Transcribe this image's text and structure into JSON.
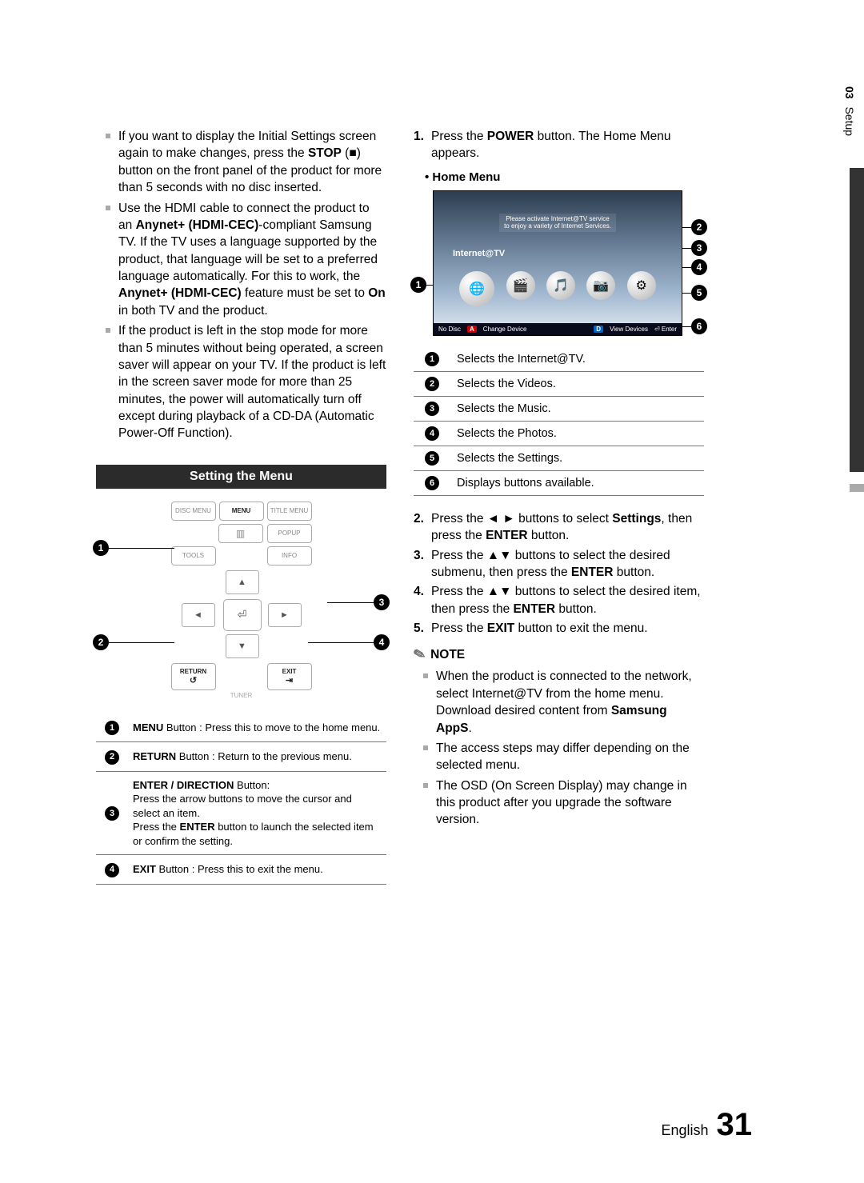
{
  "section": {
    "num": "03",
    "name": "Setup"
  },
  "left": {
    "bullets": [
      {
        "pre": "If you want to display the Initial Settings screen again to make changes, press the ",
        "b1": "STOP",
        "post": " (■) button on the front panel of the product for more than 5 seconds with no disc inserted."
      },
      {
        "pre": "Use the HDMI cable to connect the product to an ",
        "b1": "Anynet+ (HDMI-CEC)",
        "mid": "-compliant Samsung TV. If the TV uses a language supported by the product, that language will be set to a preferred language automatically. For this to work, the ",
        "b2": "Anynet+ (HDMI-CEC)",
        "mid2": " feature must be set to ",
        "b3": "On",
        "post": " in both TV and the product."
      },
      {
        "pre": "If the product is left in the stop mode for more than 5 minutes without being operated, a screen saver will appear on your TV. If the product is left in the screen saver mode for more than 25 minutes, the power will automatically turn off except during playback of a CD-DA (Automatic Power-Off Function)."
      }
    ],
    "band": "Setting the Menu",
    "remote": {
      "disc_menu": "DISC MENU",
      "menu": "MENU",
      "title_menu": "TITLE MENU",
      "popup": "POPUP",
      "tools": "TOOLS",
      "info": "INFO",
      "return": "RETURN",
      "exit": "EXIT",
      "tuner": "TUNER"
    },
    "remote_callouts": {
      "c1": "1",
      "c2": "2",
      "c3": "3",
      "c4": "4"
    },
    "remote_table": [
      {
        "n": "1",
        "b": "MENU",
        "rest": " Button : Press this to move to the home menu."
      },
      {
        "n": "2",
        "b": "RETURN",
        "rest": " Button : Return to the previous menu."
      },
      {
        "n": "3",
        "b": "ENTER / DIRECTION",
        "rest": " Button:\nPress the arrow buttons to move the cursor and select an item.\nPress the ",
        "b2": "ENTER",
        "rest2": " button to launch the selected item or confirm the setting."
      },
      {
        "n": "4",
        "b": "EXIT",
        "rest": " Button : Press this to exit the menu."
      }
    ]
  },
  "right": {
    "step1": {
      "n": "1.",
      "pre": "Press the ",
      "b": "POWER",
      "post": " button. The Home Menu appears."
    },
    "home_menu_label": "• Home Menu",
    "tv": {
      "banner1": "Please activate Internet@TV service",
      "banner2": "to enjoy a variety of Internet Services.",
      "label": "Internet@TV",
      "bar_nodisc": "No Disc",
      "bar_a": "A",
      "bar_change": "Change Device",
      "bar_d": "D",
      "bar_view": "View Devices",
      "bar_enter": "⏎ Enter"
    },
    "tv_callouts": {
      "c1": "1",
      "c2": "2",
      "c3": "3",
      "c4": "4",
      "c5": "5",
      "c6": "6"
    },
    "home_table": [
      {
        "n": "1",
        "t": "Selects the Internet@TV."
      },
      {
        "n": "2",
        "t": "Selects the Videos."
      },
      {
        "n": "3",
        "t": "Selects the Music."
      },
      {
        "n": "4",
        "t": "Selects the Photos."
      },
      {
        "n": "5",
        "t": "Selects the Settings."
      },
      {
        "n": "6",
        "t": "Displays buttons available."
      }
    ],
    "steps": [
      {
        "n": "2.",
        "pre": "Press the ◄ ► buttons to select ",
        "b": "Settings",
        "mid": ", then press the ",
        "b2": "ENTER",
        "post": " button."
      },
      {
        "n": "3.",
        "pre": "Press the ▲▼ buttons to select the desired submenu, then press the ",
        "b": "ENTER",
        "post": " button."
      },
      {
        "n": "4.",
        "pre": "Press the ▲▼ buttons to select the desired item, then press the ",
        "b": "ENTER",
        "post": " button."
      },
      {
        "n": "5.",
        "pre": "Press the ",
        "b": "EXIT",
        "post": " button to exit the menu."
      }
    ],
    "note_label": "NOTE",
    "notes": [
      {
        "pre": "When the product is connected to the network, select Internet@TV from the home menu. Download desired content from ",
        "b": "Samsung AppS",
        "post": "."
      },
      {
        "pre": "The access steps may differ depending on the selected menu."
      },
      {
        "pre": "The OSD (On Screen Display) may change in this product after you upgrade the software version."
      }
    ]
  },
  "footer": {
    "lang": "English",
    "page": "31"
  }
}
